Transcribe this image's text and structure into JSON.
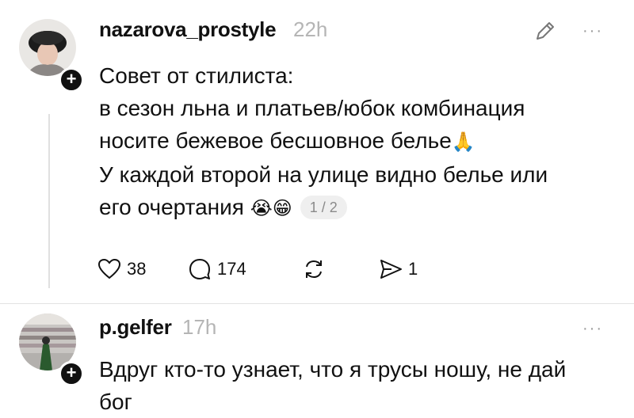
{
  "posts": [
    {
      "username": "nazarova_prostyle",
      "time": "22h",
      "lines": [
        "Совет от стилиста:",
        "в сезон льна и платьев/юбок комбинация",
        "носите бежевое бесшовное белье",
        "У каждой второй на улице видно белье или",
        "его очертания"
      ],
      "emoji_line3": "🙏",
      "emoji_line5": "😭😁",
      "page_indicator": "1 / 2",
      "stats": {
        "likes": "38",
        "replies": "174",
        "shares": "1"
      },
      "icons": [
        "heart-icon",
        "comment-icon",
        "repost-icon",
        "send-icon",
        "edit-icon",
        "more-icon",
        "follow-plus-icon"
      ]
    },
    {
      "username": "p.gelfer",
      "time": "17h",
      "lines": [
        "Вдруг кто-то узнает, что я трусы ношу, не дай",
        "бог"
      ],
      "icons": [
        "more-icon",
        "follow-plus-icon"
      ]
    }
  ],
  "more_glyph": "···",
  "plus_glyph": "+"
}
